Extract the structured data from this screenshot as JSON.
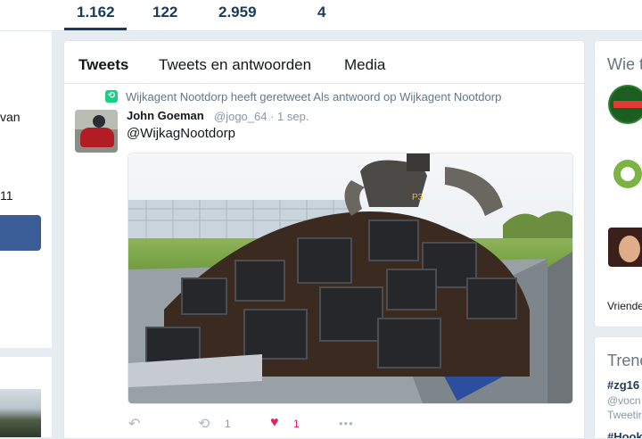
{
  "stats": {
    "items": [
      {
        "value": "1.162",
        "active": true
      },
      {
        "value": "122"
      },
      {
        "value": "2.959"
      },
      {
        "value": "4"
      }
    ]
  },
  "left_sidebar": {
    "fragment_1": "van",
    "fragment_2": "11"
  },
  "tabs": {
    "tweets": "Tweets",
    "tweets_replies": "Tweets en antwoorden",
    "media": "Media"
  },
  "tweet": {
    "retweet_context": "Wijkagent Nootdorp heeft geretweet Als antwoord op Wijkagent Nootdorp",
    "author_name": "John Goeman",
    "author_meta": "@jogo_64 · 1 sep.",
    "text": "@WijkagNootdorp",
    "retweet_count": "1",
    "like_count": "1",
    "more_label": "•••"
  },
  "right_sidebar": {
    "who_to_follow_title": "Wie t",
    "friends_label": "Vriende",
    "trends_title": "Trenc",
    "trend_1_tag": "#zg16",
    "trend_1_line1": "@vocn",
    "trend_1_line2": "Tweetir",
    "trend_2_tag": "#Hook"
  },
  "colors": {
    "accent": "#1b3a5c",
    "retweet_green": "#19cf86",
    "like_red": "#e0245e",
    "button_blue": "#3a5d97"
  }
}
